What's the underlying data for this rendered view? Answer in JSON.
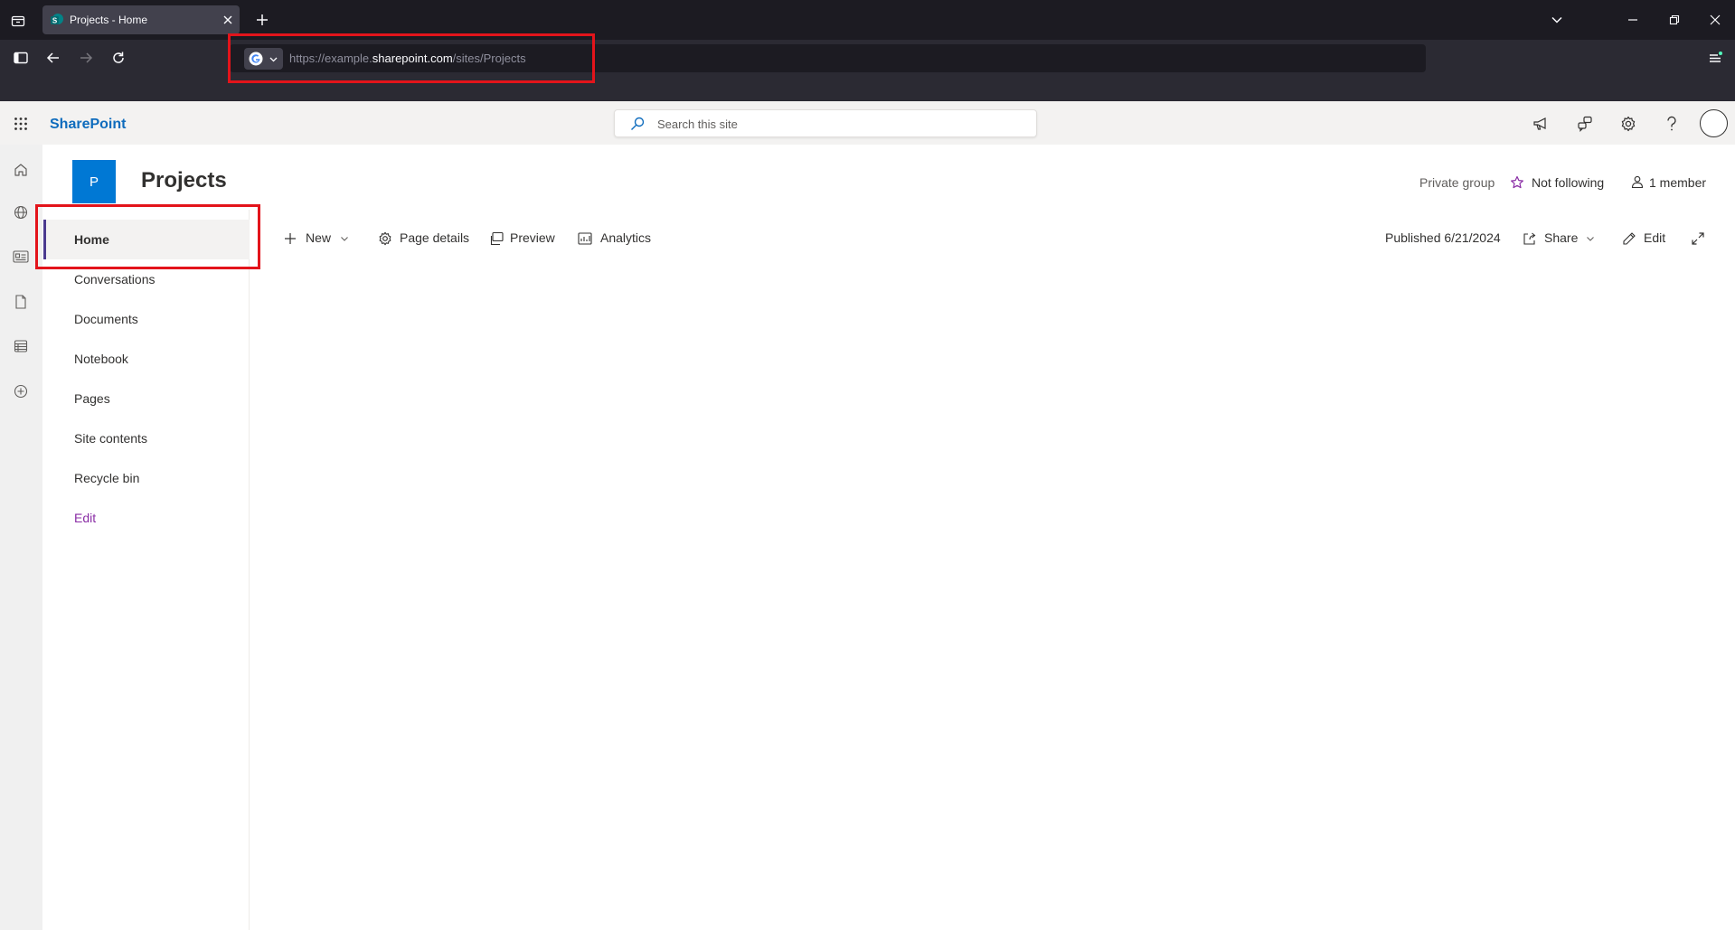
{
  "browser": {
    "tab_title": "Projects - Home",
    "url_prefix": "https://example.",
    "url_host": "sharepoint.com",
    "url_path": "/sites/Projects"
  },
  "suite": {
    "brand": "SharePoint",
    "search_placeholder": "Search this site"
  },
  "site": {
    "logo_letter": "P",
    "title": "Projects",
    "privacy": "Private group",
    "follow_label": "Not following",
    "members_label": "1 member"
  },
  "nav": {
    "items": [
      {
        "label": "Home"
      },
      {
        "label": "Conversations"
      },
      {
        "label": "Documents"
      },
      {
        "label": "Notebook"
      },
      {
        "label": "Pages"
      },
      {
        "label": "Site contents"
      },
      {
        "label": "Recycle bin"
      }
    ],
    "edit_label": "Edit"
  },
  "commandbar": {
    "new_label": "New",
    "page_details_label": "Page details",
    "preview_label": "Preview",
    "analytics_label": "Analytics",
    "published_label": "Published 6/21/2024",
    "share_label": "Share",
    "edit_label": "Edit"
  },
  "colors": {
    "brand": "#0f6cbd",
    "site_logo": "#0078d4",
    "nav_edit": "#8a2da5",
    "highlight": "#e3141b",
    "follow_star": "#8a2da5"
  }
}
